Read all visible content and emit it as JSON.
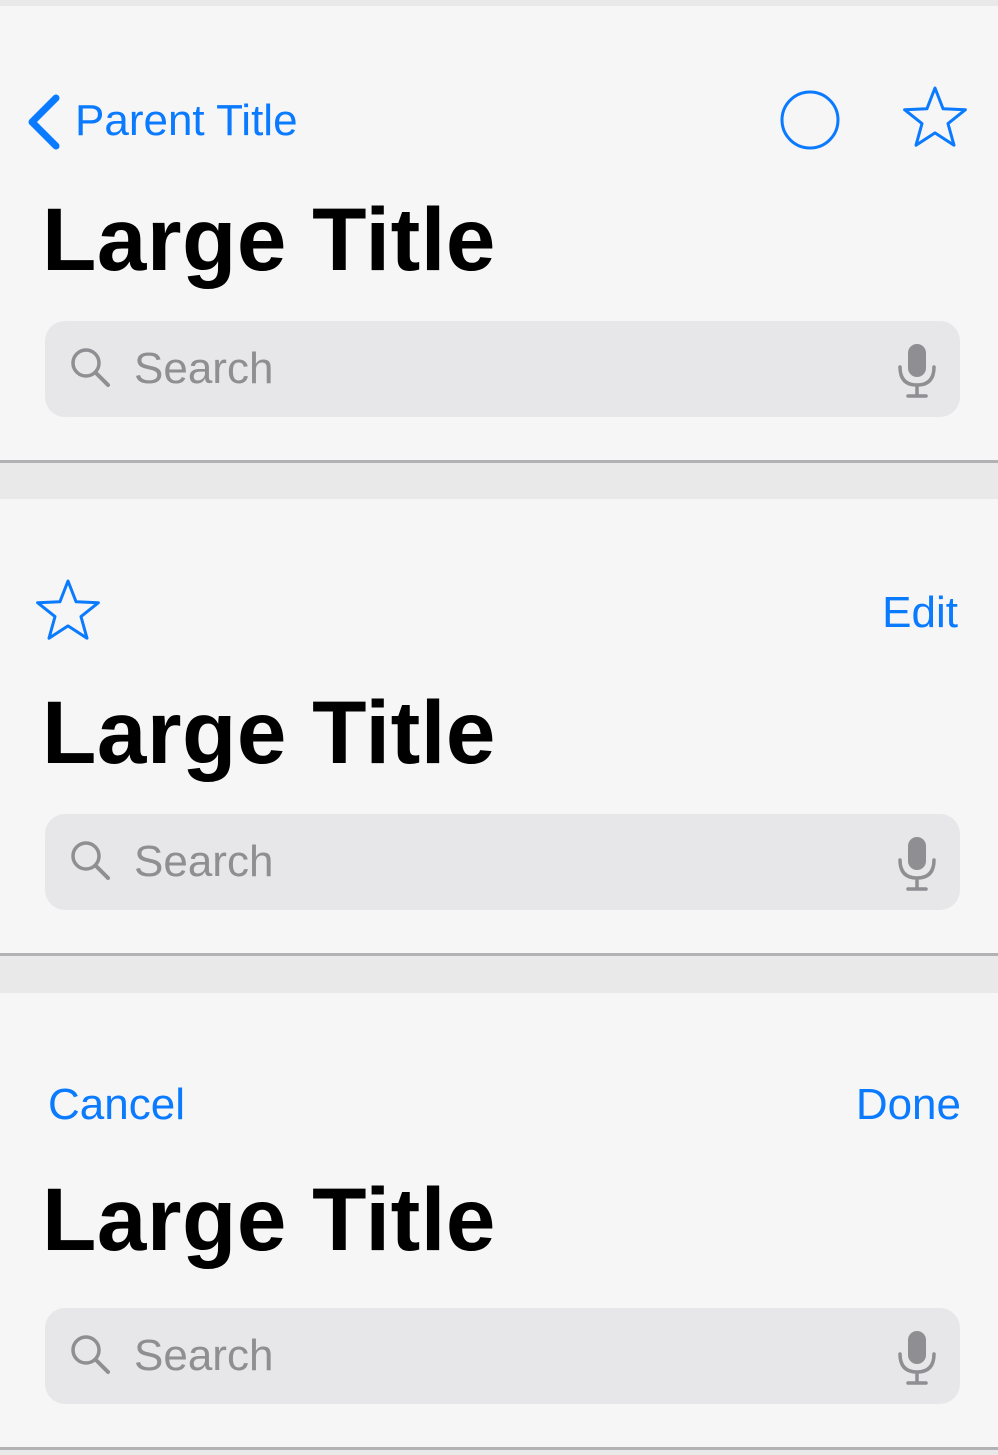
{
  "colors": {
    "tint": "#0a7aff",
    "bar_background": "#f6f6f7",
    "page_background": "#e9e9ea",
    "search_background": "#e7e7e9",
    "placeholder": "#8e8e93"
  },
  "bars": [
    {
      "back_label": "Parent Title",
      "back_icon": "chevron-left-icon",
      "right_icons": [
        "circle-icon",
        "star-icon"
      ],
      "title": "Large Title",
      "search": {
        "placeholder": "Search",
        "left_icon": "search-icon",
        "right_icon": "mic-icon"
      }
    },
    {
      "left_icon": "star-icon",
      "right_label": "Edit",
      "title": "Large Title",
      "search": {
        "placeholder": "Search",
        "left_icon": "search-icon",
        "right_icon": "mic-icon"
      }
    },
    {
      "left_label": "Cancel",
      "right_label": "Done",
      "title": "Large Title",
      "search": {
        "placeholder": "Search",
        "left_icon": "search-icon",
        "right_icon": "mic-icon"
      }
    }
  ]
}
